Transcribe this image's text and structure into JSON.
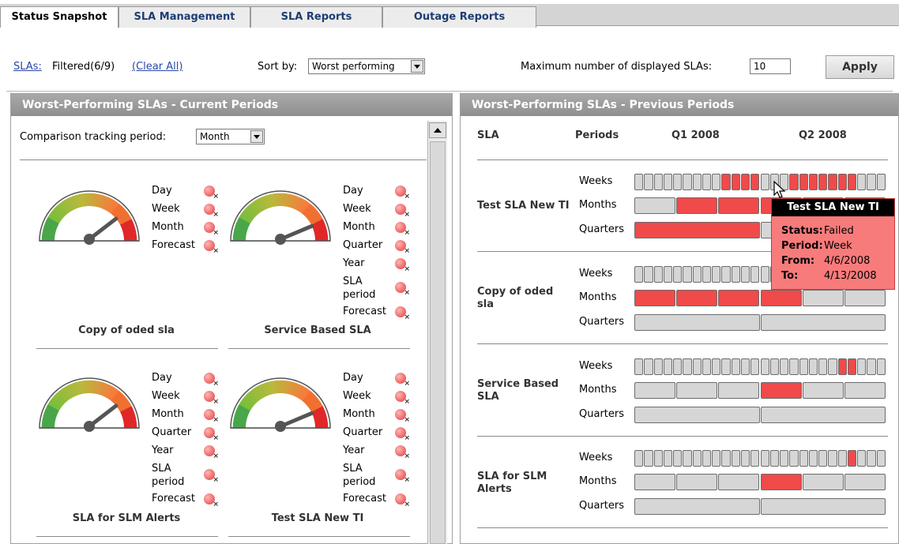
{
  "tabs": [
    {
      "label": "Status Snapshot",
      "active": true
    },
    {
      "label": "SLA Management"
    },
    {
      "label": "SLA Reports"
    },
    {
      "label": "Outage Reports"
    }
  ],
  "filter": {
    "slas_link": "SLAs:",
    "filtered_text": "Filtered(6/9)",
    "clear_all": "(Clear All)",
    "sort_label": "Sort by:",
    "sort_value": "Worst performing",
    "max_label": "Maximum number of displayed SLAs:",
    "max_value": "10",
    "apply": "Apply"
  },
  "current_panel": {
    "title": "Worst-Performing SLAs - Current Periods",
    "tracking_label": "Comparison tracking period:",
    "tracking_value": "Month",
    "gauges": [
      {
        "name": "Copy of oded sla",
        "periods": [
          "Day",
          "Week",
          "Month",
          "Forecast"
        ],
        "level": 0.78
      },
      {
        "name": "Service Based SLA",
        "periods": [
          "Day",
          "Week",
          "Month",
          "Quarter",
          "Year",
          "SLA period",
          "Forecast"
        ],
        "level": 0.86
      },
      {
        "name": "SLA for SLM Alerts",
        "periods": [
          "Day",
          "Week",
          "Month",
          "Quarter",
          "Year",
          "SLA period",
          "Forecast"
        ],
        "level": 0.78
      },
      {
        "name": "Test SLA New TI",
        "periods": [
          "Day",
          "Week",
          "Month",
          "Quarter",
          "Year",
          "SLA period",
          "Forecast"
        ],
        "level": 0.86
      }
    ]
  },
  "previous_panel": {
    "title": "Worst-Performing SLAs - Previous Periods",
    "col_sla": "SLA",
    "col_periods": "Periods",
    "q1": "Q1 2008",
    "q2": "Q2 2008",
    "row_weeks": "Weeks",
    "row_months": "Months",
    "row_quarters": "Quarters",
    "slas": [
      {
        "name": "Test SLA New TI",
        "weeks_red": [
          9,
          10,
          11,
          12,
          16,
          17,
          18,
          19,
          20,
          21,
          22
        ],
        "months_red": [
          1,
          2,
          3,
          4
        ],
        "quarters_red": [
          0
        ]
      },
      {
        "name": "Copy of oded sla",
        "weeks_red": [],
        "months_red": [
          0,
          1,
          2,
          3
        ],
        "quarters_red": []
      },
      {
        "name": "Service Based SLA",
        "weeks_red": [
          21,
          22
        ],
        "months_red": [
          3
        ],
        "quarters_red": []
      },
      {
        "name": "SLA for SLM Alerts",
        "weeks_red": [
          22
        ],
        "months_red": [
          3
        ],
        "quarters_red": []
      }
    ],
    "tooltip": {
      "title": "Test SLA New TI",
      "status_label": "Status:",
      "status_value": "Failed",
      "period_label": "Period:",
      "period_value": "Week",
      "from_label": "From:",
      "from_value": "4/6/2008",
      "to_label": "To:",
      "to_value": "4/13/2008"
    }
  }
}
